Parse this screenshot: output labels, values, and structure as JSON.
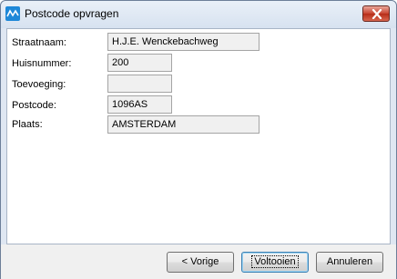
{
  "window": {
    "title": "Postcode opvragen",
    "accent_color": "#1e88d8",
    "close_button_color": "#c8432f"
  },
  "form": {
    "fields": [
      {
        "label": "Straatnaam:",
        "value": "H.J.E. Wenckebachweg"
      },
      {
        "label": "Huisnummer:",
        "value": "200"
      },
      {
        "label": "Toevoeging:",
        "value": ""
      },
      {
        "label": "Postcode:",
        "value": "1096AS"
      },
      {
        "label": "Plaats:",
        "value": "AMSTERDAM"
      }
    ]
  },
  "buttons": {
    "back": "< Vorige",
    "finish": "Voltooien",
    "cancel": "Annuleren"
  },
  "icons": {
    "app": "app-logo-icon",
    "close": "close-icon"
  }
}
